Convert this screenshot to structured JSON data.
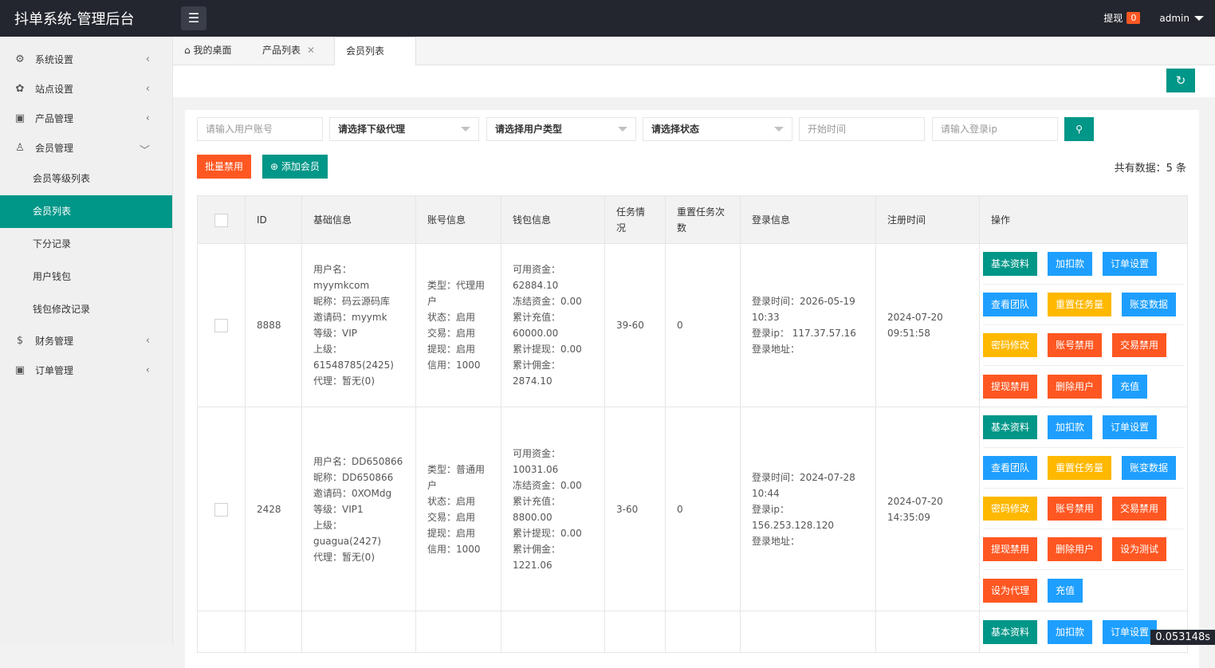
{
  "header": {
    "title": "抖单系统-管理后台",
    "withdraw_label": "提现",
    "withdraw_count": "0",
    "user": "admin"
  },
  "sidebar": {
    "items": [
      {
        "label": "系统设置",
        "icon": "gear-icon",
        "glyph": "⚙"
      },
      {
        "label": "站点设置",
        "icon": "leaf-icon",
        "glyph": "✿"
      },
      {
        "label": "产品管理",
        "icon": "cube-icon",
        "glyph": "▣"
      },
      {
        "label": "会员管理",
        "icon": "user-icon",
        "glyph": "♙"
      }
    ],
    "sub_items": [
      "会员等级列表",
      "会员列表",
      "下分记录",
      "用户钱包",
      "钱包修改记录"
    ],
    "items_after": [
      {
        "label": "财务管理",
        "icon": "dollar-icon",
        "glyph": "$"
      },
      {
        "label": "订单管理",
        "icon": "cube-icon",
        "glyph": "▣"
      }
    ]
  },
  "tabs": [
    "我的桌面",
    "产品列表",
    "会员列表"
  ],
  "filters": {
    "account_placeholder": "请输入用户账号",
    "agent_select": "请选择下级代理",
    "type_select": "请选择用户类型",
    "status_select": "请选择状态",
    "start_time_placeholder": "开始时间",
    "ip_placeholder": "请输入登录ip"
  },
  "toolbar": {
    "batch_disable": "批量禁用",
    "add_member": "添加会员",
    "total_text": "共有数据：5 条"
  },
  "table": {
    "headers": [
      "ID",
      "基础信息",
      "账号信息",
      "钱包信息",
      "任务情况",
      "重置任务次数",
      "登录信息",
      "注册时间",
      "操作"
    ],
    "rows": [
      {
        "id": "8888",
        "basic": [
          "用户名：myymkcom",
          "昵称：码云源码库",
          "邀请码：myymk",
          "等级：VIP",
          "上级：61548785(2425)",
          "代理：暂无(0)"
        ],
        "account": [
          "类型：代理用户",
          "状态：启用",
          "交易：启用",
          "提现：启用",
          "信用：1000"
        ],
        "wallet": [
          "可用资金：62884.10",
          "冻结资金：0.00",
          "累计充值：60000.00",
          "累计提现：0.00",
          "累计佣金：2874.10"
        ],
        "task": "39-60",
        "reset": "0",
        "login": [
          "登录时间：2026-05-19 10:33",
          "登录ip： 117.37.57.16",
          "登录地址："
        ],
        "reg": "2024-07-20 09:51:58",
        "ops": [
          [
            "基本资料",
            "加扣款",
            "订单设置"
          ],
          [
            "查看团队",
            "重置任务量",
            "账变数据"
          ],
          [
            "密码修改",
            "账号禁用",
            "交易禁用"
          ],
          [
            "提现禁用",
            "删除用户",
            "充值"
          ]
        ]
      },
      {
        "id": "2428",
        "basic": [
          "用户名：DD650866",
          "昵称：DD650866",
          "邀请码：0XOMdg",
          "等级：VIP1",
          "上级：guagua(2427)",
          "代理：暂无(0)"
        ],
        "account": [
          "类型：普通用户",
          "状态：启用",
          "交易：启用",
          "提现：启用",
          "信用：1000"
        ],
        "wallet": [
          "可用资金：10031.06",
          "冻结资金：0.00",
          "累计充值：8800.00",
          "累计提现：0.00",
          "累计佣金：1221.06"
        ],
        "task": "3-60",
        "reset": "0",
        "login": [
          "登录时间：2024-07-28 10:44",
          "登录ip： 156.253.128.120",
          "登录地址："
        ],
        "reg": "2024-07-20 14:35:09",
        "ops": [
          [
            "基本资料",
            "加扣款",
            "订单设置"
          ],
          [
            "查看团队",
            "重置任务量",
            "账变数据"
          ],
          [
            "密码修改",
            "账号禁用",
            "交易禁用"
          ],
          [
            "提现禁用",
            "删除用户",
            "设为测试"
          ],
          [
            "设为代理",
            "充值"
          ]
        ]
      },
      {
        "id": "",
        "basic": [],
        "account": [],
        "wallet": [],
        "task": "",
        "reset": "",
        "login": [],
        "reg": "",
        "ops": [
          [
            "基本资料",
            "加扣款",
            "订单设置"
          ]
        ]
      }
    ]
  },
  "timer": "0.053148s"
}
